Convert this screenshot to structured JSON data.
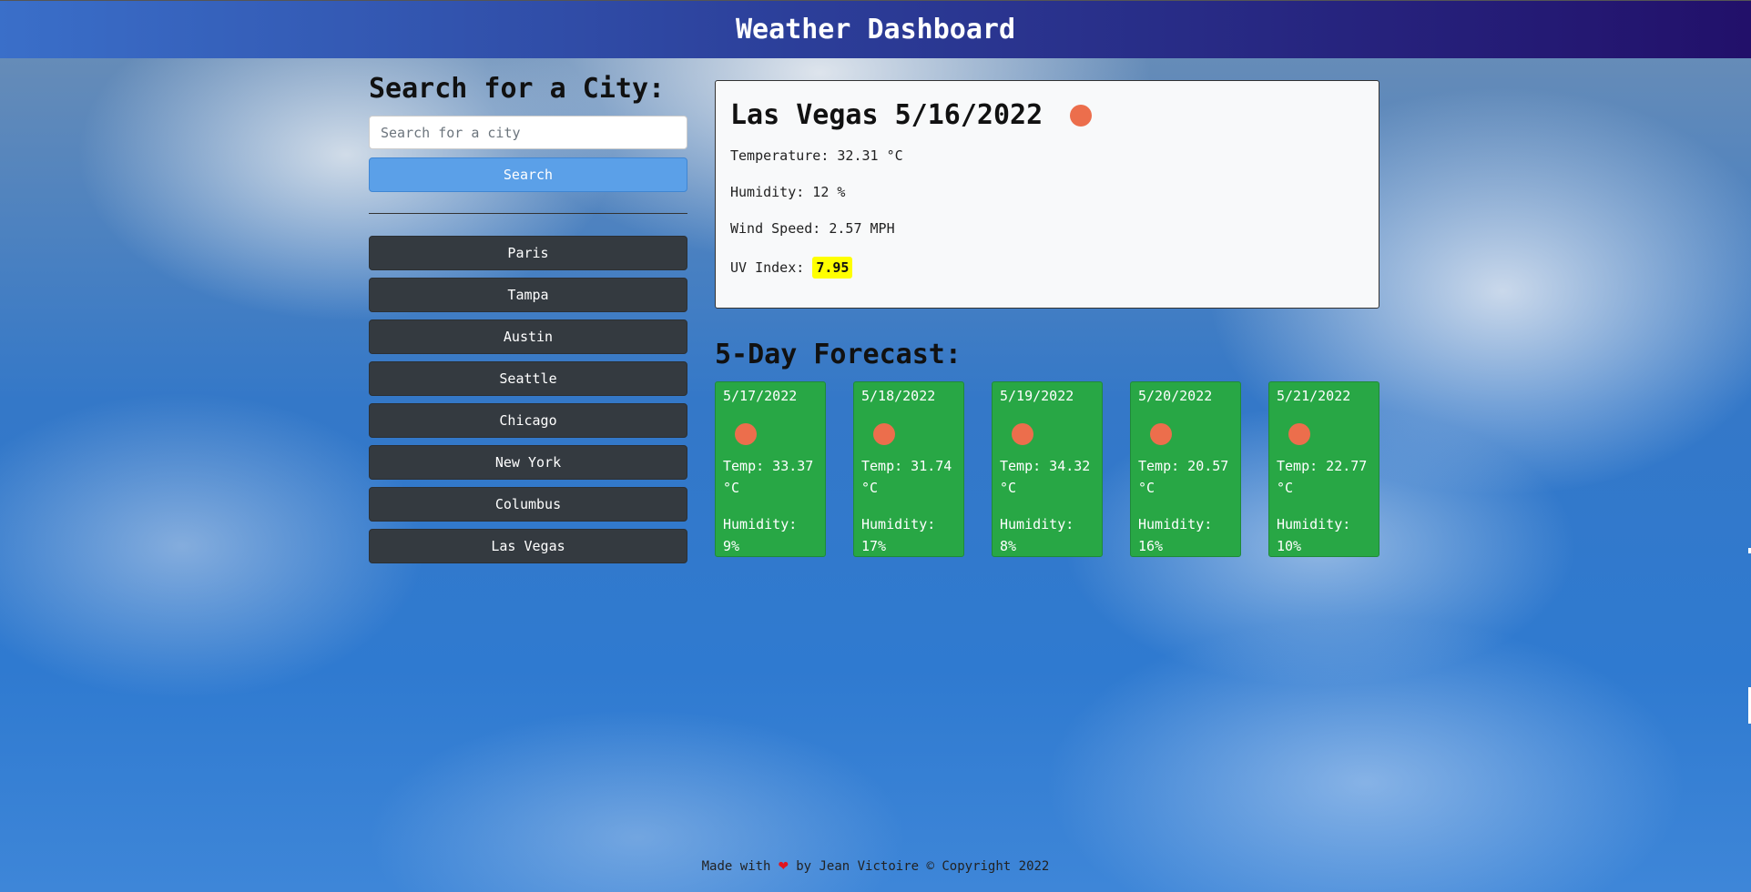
{
  "header": {
    "title": "Weather Dashboard"
  },
  "search": {
    "heading": "Search for a City:",
    "placeholder": "Search for a city",
    "button_label": "Search"
  },
  "history": [
    {
      "label": "Paris"
    },
    {
      "label": "Tampa"
    },
    {
      "label": "Austin"
    },
    {
      "label": "Seattle"
    },
    {
      "label": "Chicago"
    },
    {
      "label": "New York"
    },
    {
      "label": "Columbus"
    },
    {
      "label": "Las Vegas"
    }
  ],
  "current": {
    "title": "Las Vegas 5/16/2022",
    "icon": "sun-icon",
    "temperature": "Temperature: 32.31 °C",
    "humidity": "Humidity: 12 %",
    "wind": "Wind Speed: 2.57 MPH",
    "uv_label": "UV Index:",
    "uv_value": "7.95",
    "uv_color": "#ffff00"
  },
  "forecast": {
    "title": "5-Day Forecast:",
    "days": [
      {
        "date": "5/17/2022",
        "temp": "Temp: 33.37 °C",
        "humidity": "Humidity: 9%"
      },
      {
        "date": "5/18/2022",
        "temp": "Temp: 31.74 °C",
        "humidity": "Humidity: 17%"
      },
      {
        "date": "5/19/2022",
        "temp": "Temp: 34.32 °C",
        "humidity": "Humidity: 8%"
      },
      {
        "date": "5/20/2022",
        "temp": "Temp: 20.57 °C",
        "humidity": "Humidity: 16%"
      },
      {
        "date": "5/21/2022",
        "temp": "Temp: 22.77 °C",
        "humidity": "Humidity: 10%"
      }
    ]
  },
  "footer": {
    "prefix": "Made with",
    "heart": "❤",
    "suffix": "by Jean Victoire © Copyright 2022"
  },
  "colors": {
    "header_start": "#3a6fc9",
    "header_end": "#22106a",
    "search_button": "#5ba0e8",
    "history_button": "#343a40",
    "forecast_card": "#28a745",
    "weather_icon": "#ec6e4c"
  }
}
